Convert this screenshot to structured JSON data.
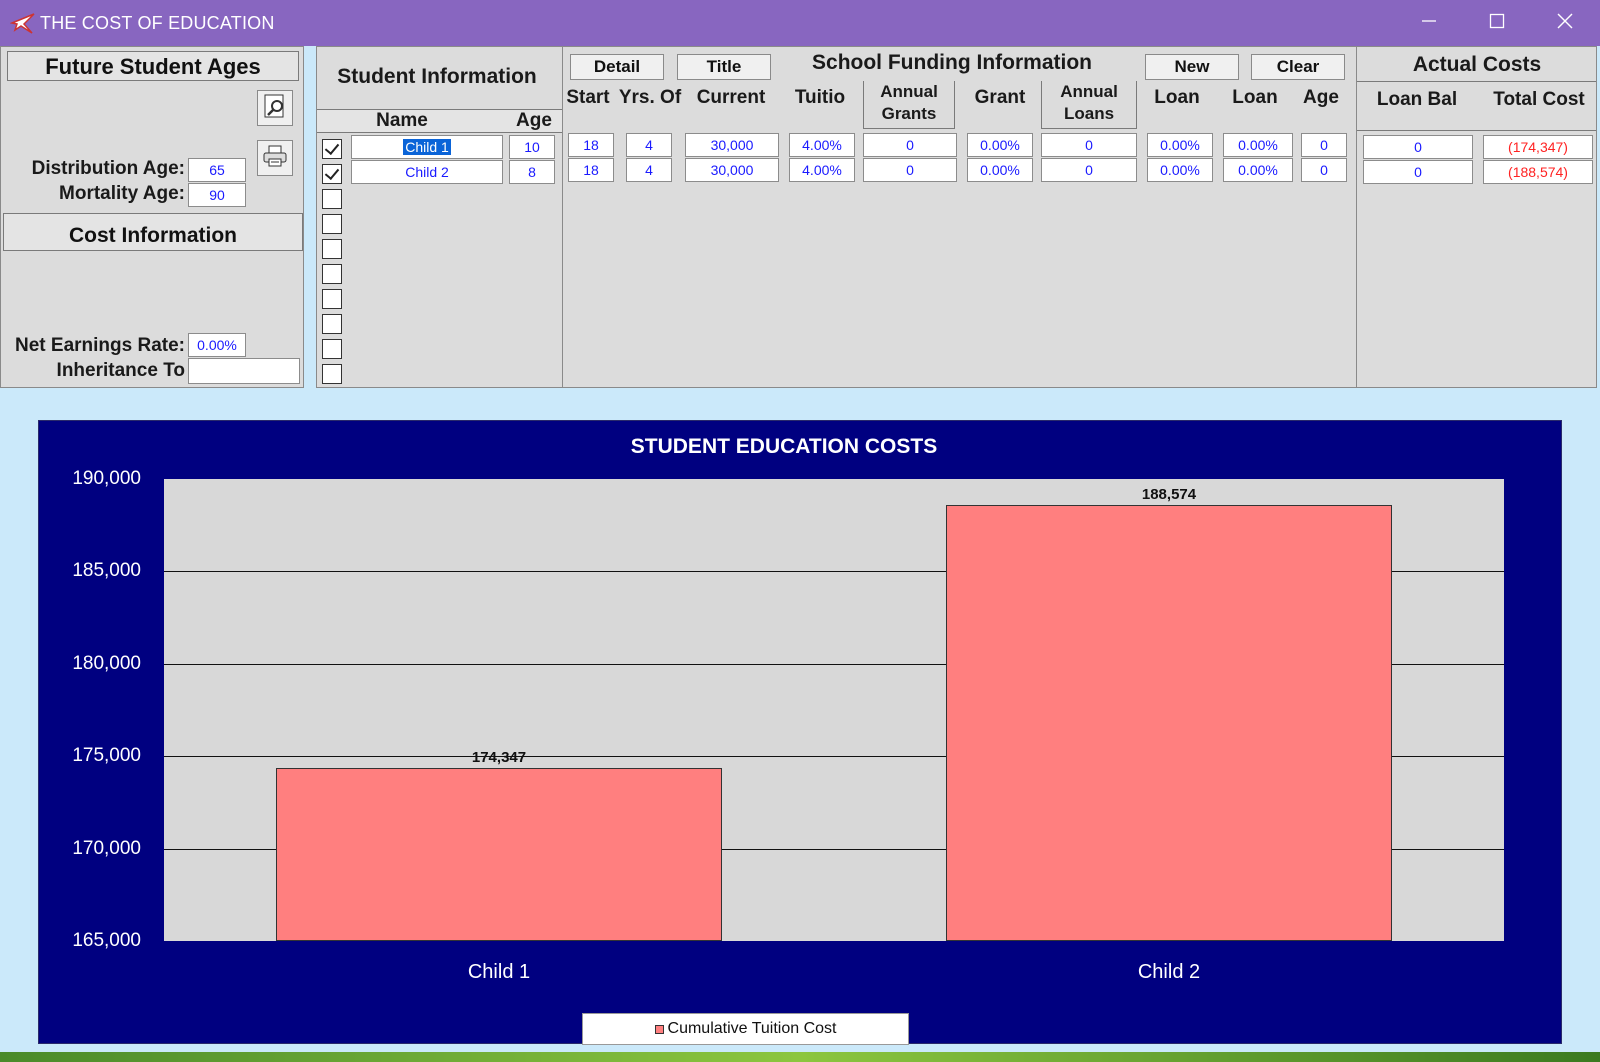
{
  "window": {
    "title": "THE COST OF EDUCATION"
  },
  "left_panel": {
    "header": "Future Student Ages",
    "distribution_label": "Distribution Age:",
    "distribution_value": "65",
    "mortality_label": "Mortality Age:",
    "mortality_value": "90",
    "cost_header": "Cost Information",
    "net_earnings_label": "Net Earnings Rate:",
    "net_earnings_value": "0.00%",
    "inheritance_label": "Inheritance To",
    "inheritance_value": ""
  },
  "student_panel": {
    "header": "Student Information",
    "col_name": "Name",
    "col_age": "Age",
    "rows": [
      {
        "checked": true,
        "name": "Child 1",
        "age": "10"
      },
      {
        "checked": true,
        "name": "Child 2",
        "age": "8"
      },
      {
        "checked": false
      },
      {
        "checked": false
      },
      {
        "checked": false
      },
      {
        "checked": false
      },
      {
        "checked": false
      },
      {
        "checked": false
      },
      {
        "checked": false
      },
      {
        "checked": false
      }
    ]
  },
  "funding_panel": {
    "title": "School Funding Information",
    "buttons": {
      "detail": "Detail",
      "title": "Title",
      "new": "New",
      "clear": "Clear"
    },
    "columns": [
      "Start",
      "Yrs. Of",
      "Current",
      "Tuitio",
      "Annual Grants",
      "Grant",
      "Annual Loans",
      "Loan",
      "Loan",
      "Age"
    ],
    "col_annual_grants_1": "Annual",
    "col_annual_grants_2": "Grants",
    "col_annual_loans_1": "Annual",
    "col_annual_loans_2": "Loans",
    "rows": [
      {
        "start": "18",
        "yrs": "4",
        "current": "30,000",
        "tuition": "4.00%",
        "annual_grants": "0",
        "grant": "0.00%",
        "annual_loans": "0",
        "loan1": "0.00%",
        "loan2": "0.00%",
        "age": "0"
      },
      {
        "start": "18",
        "yrs": "4",
        "current": "30,000",
        "tuition": "4.00%",
        "annual_grants": "0",
        "grant": "0.00%",
        "annual_loans": "0",
        "loan1": "0.00%",
        "loan2": "0.00%",
        "age": "0"
      }
    ]
  },
  "actual_panel": {
    "header": "Actual Costs",
    "col_loan_bal": "Loan Bal",
    "col_total_cost": "Total Cost",
    "rows": [
      {
        "loan_bal": "0",
        "total_cost": "(174,347)"
      },
      {
        "loan_bal": "0",
        "total_cost": "(188,574)"
      }
    ]
  },
  "colors": {
    "titlebar": "#8866c0",
    "chart_bg": "#000080",
    "plot_bg": "#d8d8d8",
    "bar": "#ff7f7f",
    "field_text": "#1a1aff",
    "negative": "#ff2222"
  },
  "icons": [
    "airplane-app-icon",
    "preview-icon",
    "printer-icon"
  ],
  "chart_data": {
    "type": "bar",
    "title": "STUDENT EDUCATION COSTS",
    "categories": [
      "Child 1",
      "Child 2"
    ],
    "series": [
      {
        "name": "Cumulative Tuition Cost",
        "values": [
          174347,
          188574
        ]
      }
    ],
    "data_labels": [
      "174,347",
      "188,574"
    ],
    "ylim": [
      165000,
      190000
    ],
    "yticks": [
      190000,
      185000,
      180000,
      175000,
      170000,
      165000
    ],
    "ytick_labels": [
      "190,000",
      "185,000",
      "180,000",
      "175,000",
      "170,000",
      "165,000"
    ],
    "grid": true,
    "legend": "bottom"
  }
}
